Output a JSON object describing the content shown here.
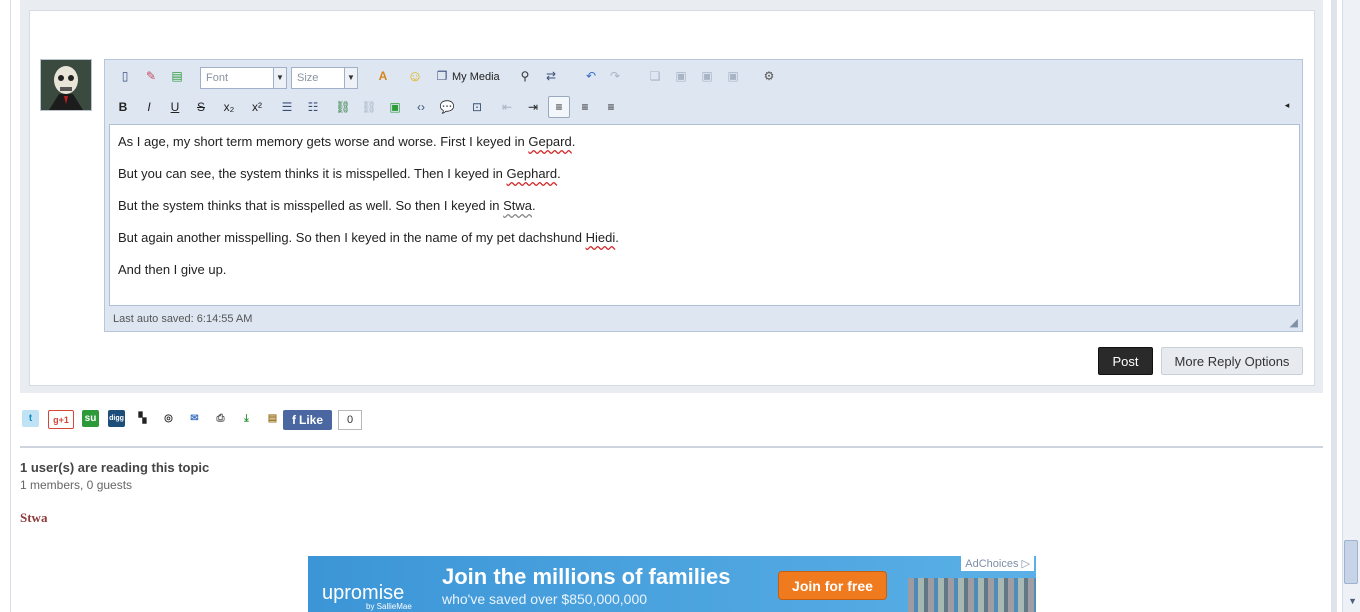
{
  "editor": {
    "toolbar": {
      "font_select": "Font",
      "size_select": "Size",
      "my_media_label": "My Media"
    },
    "content_lines": [
      {
        "before": "As I age, my short term memory gets worse and worse. First I keyed in ",
        "word": "Gepard",
        "after": "."
      },
      {
        "before": "But you can see, the system thinks it is misspelled. Then I keyed in ",
        "word": "Gephard",
        "after": "."
      },
      {
        "before": "But the system thinks that is misspelled as well. So then I keyed in ",
        "word": "Stwa",
        "after": "."
      },
      {
        "before": "But again another misspelling. So then I keyed in the name of my pet dachshund ",
        "word": "Hiedi",
        "after": "."
      },
      {
        "before": "And then I give up.",
        "word": "",
        "after": ""
      }
    ],
    "autosave": "Last auto saved: 6:14:55 AM"
  },
  "buttons": {
    "post": "Post",
    "more_reply": "More Reply Options"
  },
  "share": {
    "like_label": "Like",
    "like_count": "0"
  },
  "readers": {
    "title": "1 user(s) are reading this topic",
    "subtitle": "1 members, 0 guests",
    "names": [
      "Stwa"
    ]
  },
  "ad": {
    "logo": "upromise",
    "logo_sub": "by SallieMae",
    "headline": "Join the millions of families",
    "subline": "who've saved over $850,000,000",
    "cta": "Join for free",
    "adchoices": "AdChoices"
  }
}
